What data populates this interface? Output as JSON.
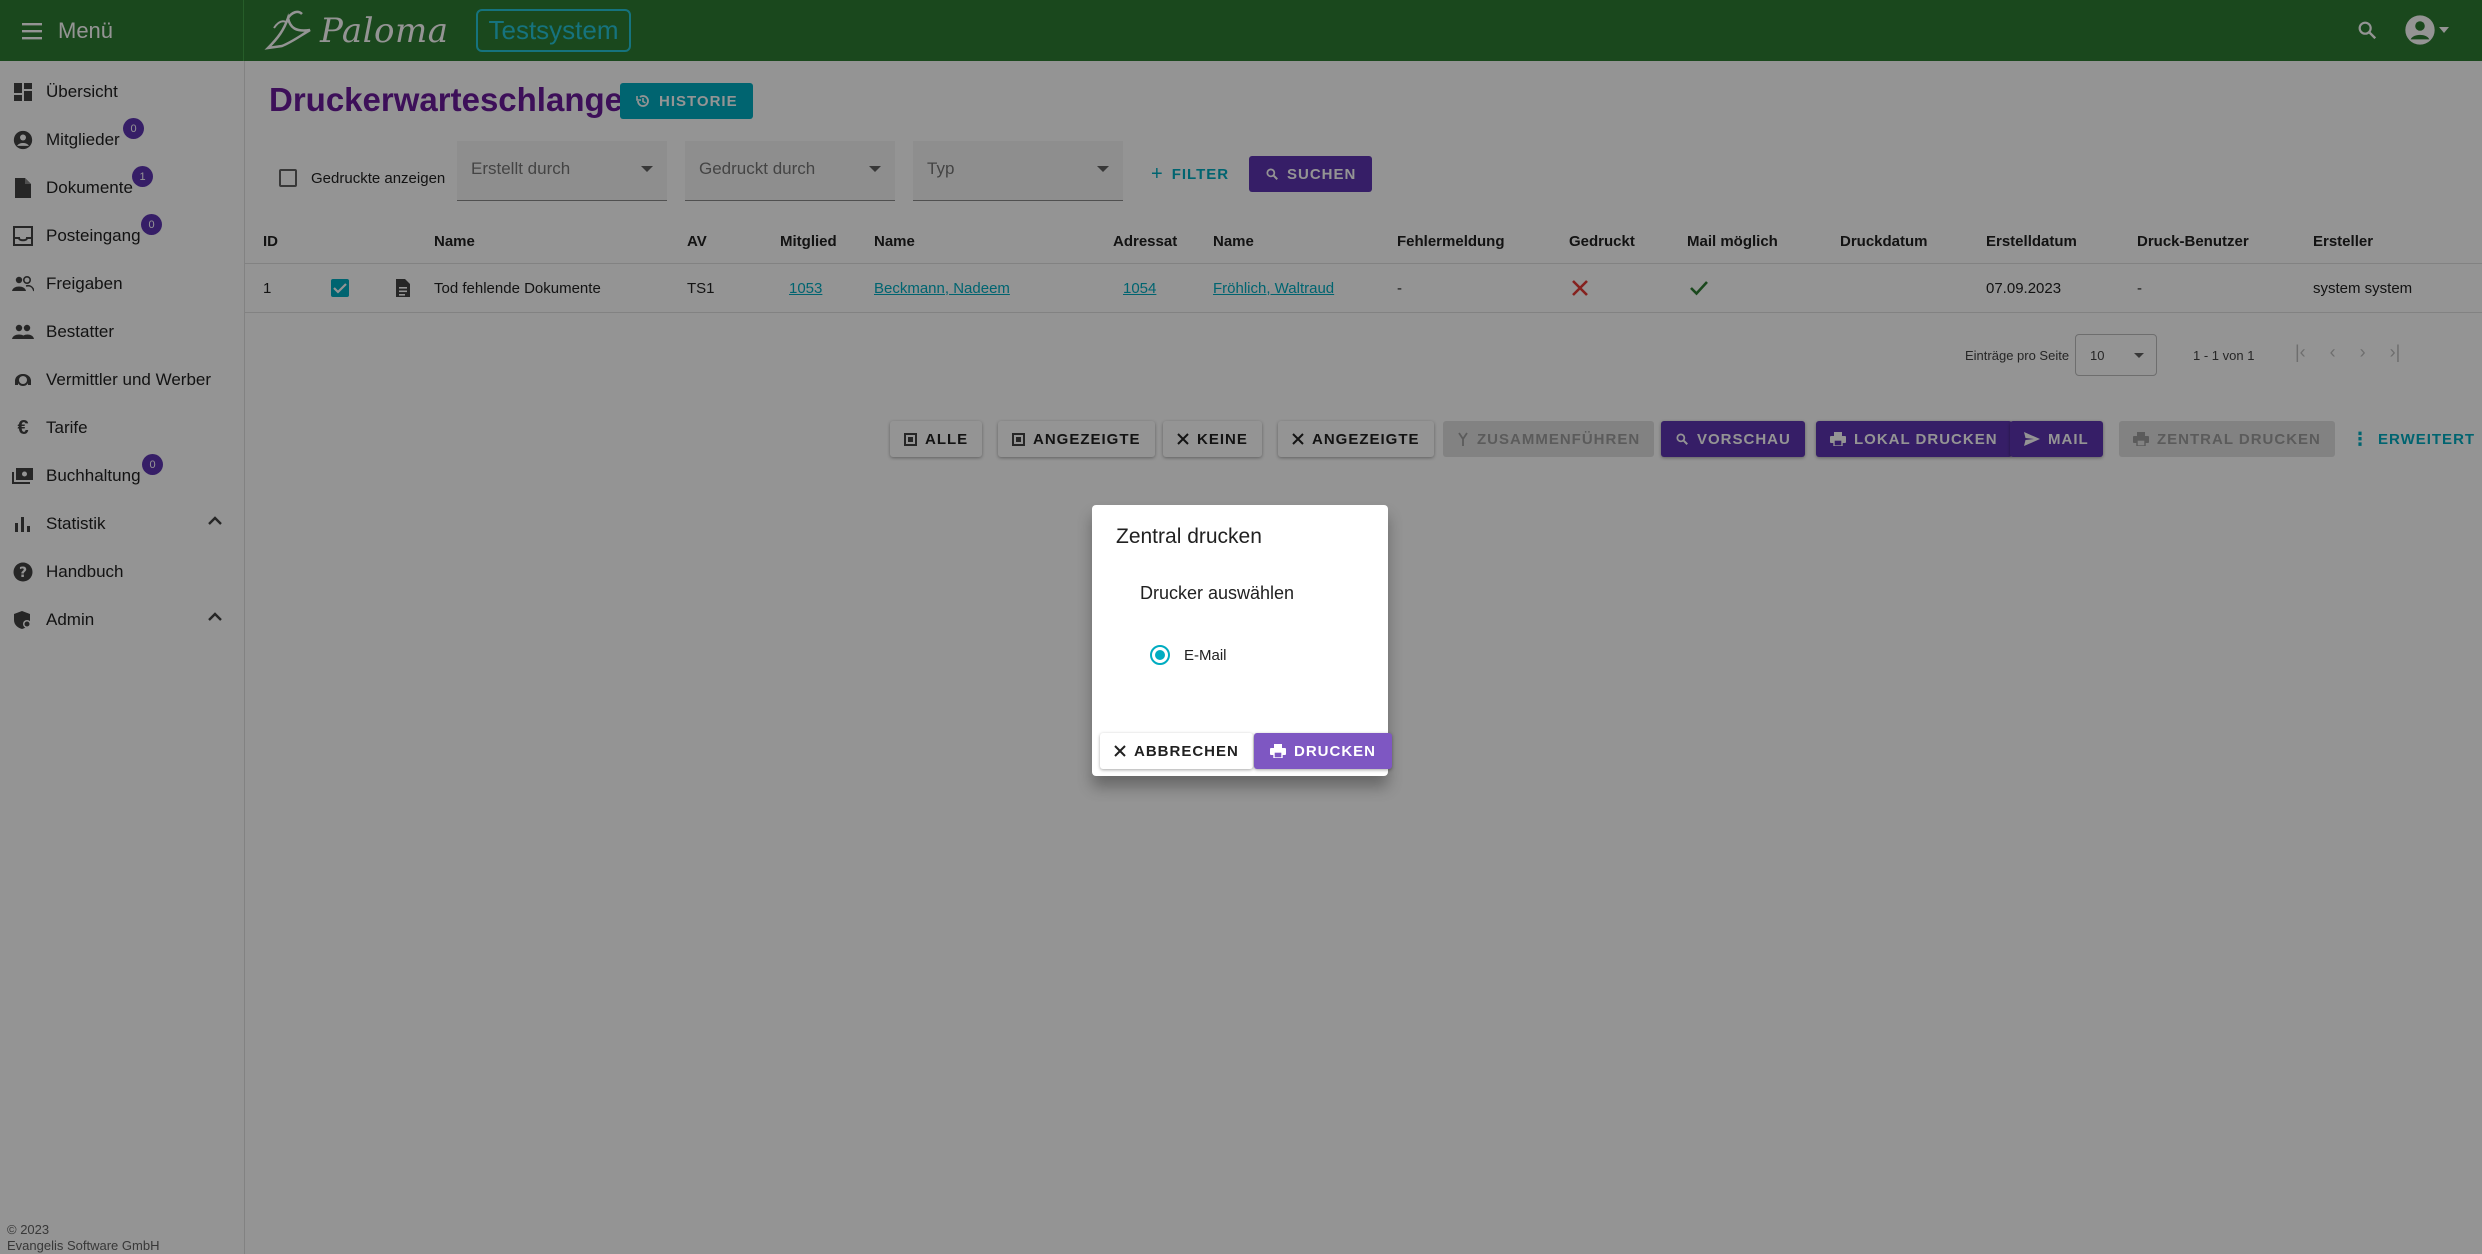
{
  "header": {
    "menu_label": "Menü",
    "logo_text": "Paloma",
    "env_badge": "Testsystem"
  },
  "sidebar": {
    "items": [
      {
        "label": "Übersicht",
        "icon": "dashboard-icon"
      },
      {
        "label": "Mitglieder",
        "icon": "account-circle-icon",
        "badge": "0"
      },
      {
        "label": "Dokumente",
        "icon": "document-icon",
        "badge": "1"
      },
      {
        "label": "Posteingang",
        "icon": "inbox-icon",
        "badge": "0"
      },
      {
        "label": "Freigaben",
        "icon": "people-icon"
      },
      {
        "label": "Bestatter",
        "icon": "group-icon"
      },
      {
        "label": "Vermittler und Werber",
        "icon": "support-agent-icon"
      },
      {
        "label": "Tarife",
        "icon": "euro-icon"
      },
      {
        "label": "Buchhaltung",
        "icon": "payments-icon",
        "badge": "0"
      },
      {
        "label": "Statistik",
        "icon": "bar-chart-icon"
      },
      {
        "label": "Handbuch",
        "icon": "help-icon"
      },
      {
        "label": "Admin",
        "icon": "admin-icon"
      }
    ],
    "copyright_line1": "© 2023",
    "copyright_line2": "Evangelis Software GmbH"
  },
  "page": {
    "title": "Druckerwarteschlange",
    "history_button": "HISTORIE"
  },
  "filters": {
    "show_printed_label": "Gedruckte anzeigen",
    "created_by_placeholder": "Erstellt durch",
    "printed_by_placeholder": "Gedruckt durch",
    "type_placeholder": "Typ",
    "filter_button": "FILTER",
    "search_button": "SUCHEN"
  },
  "table": {
    "columns": [
      "ID",
      "Name",
      "AV",
      "Mitglied",
      "Name",
      "Adressat",
      "Name",
      "Fehlermeldung",
      "Gedruckt",
      "Mail möglich",
      "Druckdatum",
      "Erstelldatum",
      "Druck-Benutzer",
      "Ersteller"
    ],
    "rows": [
      {
        "id": "1",
        "name": "Tod fehlende Dokumente",
        "av": "TS1",
        "member": "1053",
        "member_name": "Beckmann, Nadeem",
        "addressee": "1054",
        "addressee_name": "Fröhlich, Waltraud",
        "error": "-",
        "print_date": "",
        "created_date": "07.09.2023",
        "print_user": "-",
        "creator": "system system"
      }
    ]
  },
  "pager": {
    "per_page_label": "Einträge pro Seite",
    "per_page_value": "10",
    "range": "1 - 1 von 1"
  },
  "actions": {
    "all": "ALLE",
    "shown_select": "ANGEZEIGTE",
    "none": "KEINE",
    "shown_deselect": "ANGEZEIGTE",
    "merge": "ZUSAMMENFÜHREN",
    "preview": "VORSCHAU",
    "local_print": "LOKAL DRUCKEN",
    "mail": "MAIL",
    "central_print": "ZENTRAL DRUCKEN",
    "extended": "ERWEITERT"
  },
  "dialog": {
    "title": "Zentral drucken",
    "subtitle": "Drucker auswählen",
    "option": "E-Mail",
    "cancel": "ABBRECHEN",
    "print": "DRUCKEN"
  },
  "colors": {
    "topbar": "#2e7d32",
    "accent": "#00acc1",
    "primary": "#5e35b1",
    "title": "#6a1b9a"
  }
}
